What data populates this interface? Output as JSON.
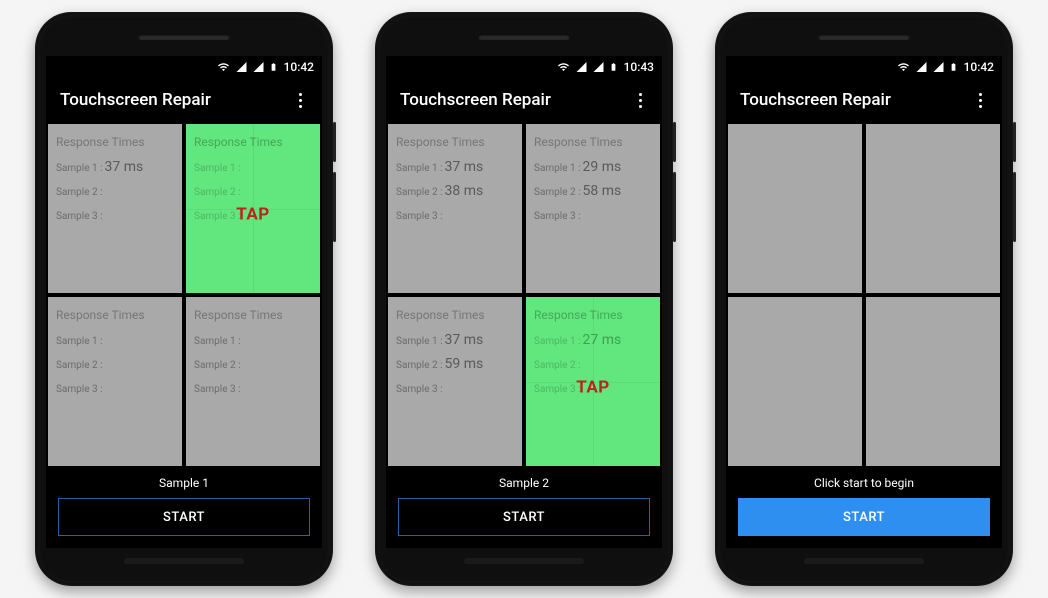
{
  "statusbar": {
    "time": [
      "10:42",
      "10:43",
      "10:42"
    ]
  },
  "app_title": "Touchscreen Repair",
  "quad_header": "Response Times",
  "sample_labels": [
    "Sample 1 :",
    "Sample 2 :",
    "Sample 3 :"
  ],
  "tap_label": "TAP",
  "start_label": "START",
  "phones": [
    {
      "status_text": "Sample 1",
      "button_variant": "outline",
      "quads": [
        {
          "active": false,
          "blank": false,
          "values": [
            "37 ms",
            "",
            ""
          ]
        },
        {
          "active": true,
          "blank": false,
          "values": [
            "",
            "",
            ""
          ],
          "show_tap": true
        },
        {
          "active": false,
          "blank": false,
          "values": [
            "",
            "",
            ""
          ]
        },
        {
          "active": false,
          "blank": false,
          "values": [
            "",
            "",
            ""
          ]
        }
      ]
    },
    {
      "status_text": "Sample 2",
      "button_variant": "outline",
      "quads": [
        {
          "active": false,
          "blank": false,
          "values": [
            "37 ms",
            "38 ms",
            ""
          ]
        },
        {
          "active": false,
          "blank": false,
          "values": [
            "29 ms",
            "58 ms",
            ""
          ]
        },
        {
          "active": false,
          "blank": false,
          "values": [
            "37 ms",
            "59 ms",
            ""
          ]
        },
        {
          "active": true,
          "blank": false,
          "values": [
            "27 ms",
            "",
            ""
          ],
          "show_tap": true
        }
      ]
    },
    {
      "status_text": "Click start to begin",
      "button_variant": "primary",
      "quads": [
        {
          "blank": true
        },
        {
          "blank": true
        },
        {
          "blank": true
        },
        {
          "blank": true
        }
      ]
    }
  ]
}
